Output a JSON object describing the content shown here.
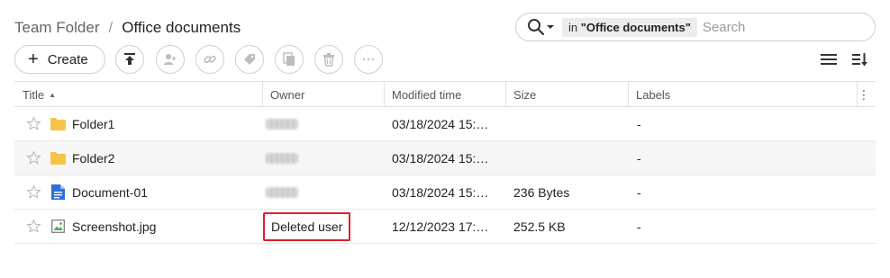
{
  "breadcrumb": {
    "root": "Team Folder",
    "separator": "/",
    "current": "Office documents"
  },
  "search": {
    "scope_prefix": "in",
    "scope_value": "\"Office documents\"",
    "placeholder": "Search"
  },
  "toolbar": {
    "create_label": "Create",
    "icons": [
      "upload-icon",
      "share-user-icon",
      "link-icon",
      "tag-icon",
      "copy-icon",
      "trash-icon",
      "more-icon"
    ],
    "view_icons": [
      "list-view-icon",
      "sort-icon"
    ]
  },
  "table": {
    "columns": [
      "Title",
      "Owner",
      "Modified time",
      "Size",
      "Labels"
    ],
    "rows": [
      {
        "name": "Folder1",
        "type": "folder",
        "owner": "",
        "modified": "03/18/2024 15:…",
        "size": "",
        "labels": "-"
      },
      {
        "name": "Folder2",
        "type": "folder",
        "owner": "",
        "modified": "03/18/2024 15:…",
        "size": "",
        "labels": "-"
      },
      {
        "name": "Document-01",
        "type": "document",
        "owner": "",
        "modified": "03/18/2024 15:…",
        "size": "236 Bytes",
        "labels": "-"
      },
      {
        "name": "Screenshot.jpg",
        "type": "image",
        "owner": "Deleted user",
        "modified": "12/12/2023 17:…",
        "size": "252.5 KB",
        "labels": "-"
      }
    ]
  },
  "colors": {
    "folder": "#f7c34b",
    "document": "#2f6fd6",
    "image": "#4caf50",
    "highlight_border": "#e01e2e",
    "row_alt_bg": "#f6f6f6"
  }
}
